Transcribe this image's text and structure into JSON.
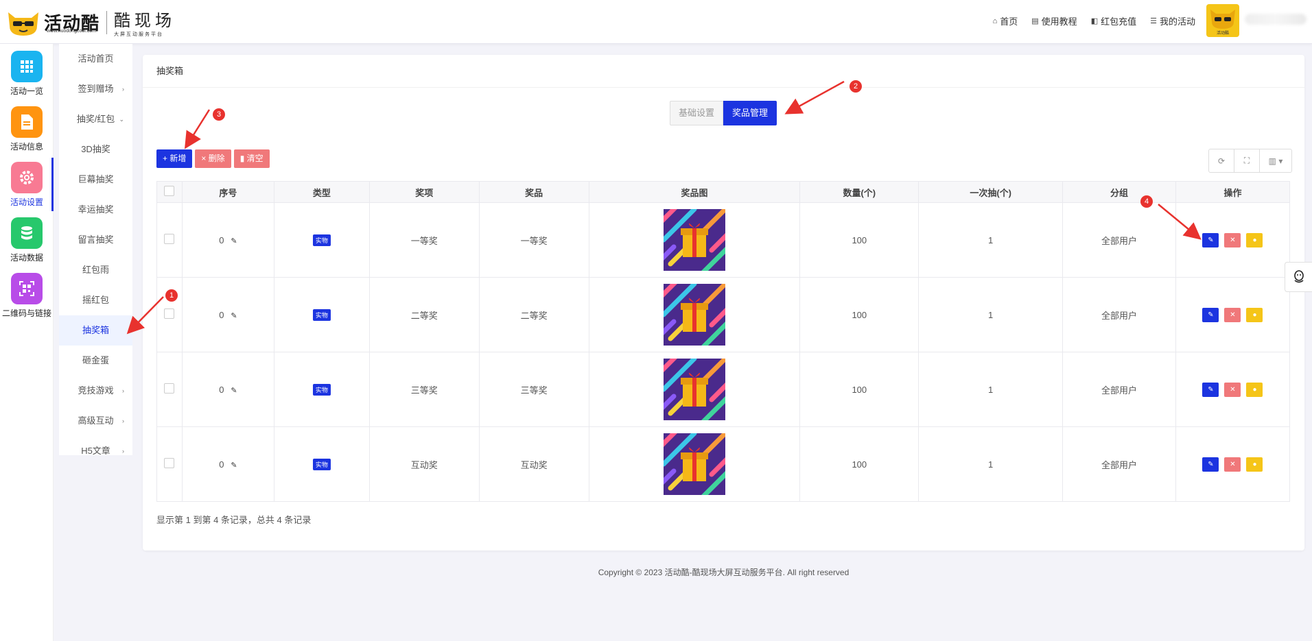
{
  "header": {
    "brand_name": "活动酷",
    "brand_url": "www.huodongcool.com",
    "brand_sub": "酷现场",
    "brand_sub_small": "大屏互动服务平台",
    "nav": [
      {
        "icon": "home-icon",
        "label": "首页"
      },
      {
        "icon": "book-icon",
        "label": "使用教程"
      },
      {
        "icon": "wallet-icon",
        "label": "红包充值"
      },
      {
        "icon": "list-icon",
        "label": "我的活动"
      }
    ],
    "avatar_caption": "活动酷"
  },
  "rail": [
    {
      "label": "活动一览",
      "icon": "grid-icon",
      "color": "#1ab4f0"
    },
    {
      "label": "活动信息",
      "icon": "document-icon",
      "color": "#ff9410"
    },
    {
      "label": "活动设置",
      "icon": "gear-icon",
      "color": "#f87a93",
      "active": true
    },
    {
      "label": "活动数据",
      "icon": "database-icon",
      "color": "#27c86c"
    },
    {
      "label": "二维码与链接",
      "icon": "qrcode-icon",
      "color": "#b84ce8"
    }
  ],
  "submenu": [
    {
      "label": "活动首页",
      "chevron": ""
    },
    {
      "label": "签到赠场",
      "chevron": "›"
    },
    {
      "label": "抽奖/红包",
      "chevron": "⌄"
    },
    {
      "label": "3D抽奖",
      "chevron": ""
    },
    {
      "label": "巨幕抽奖",
      "chevron": ""
    },
    {
      "label": "幸运抽奖",
      "chevron": ""
    },
    {
      "label": "留言抽奖",
      "chevron": ""
    },
    {
      "label": "红包雨",
      "chevron": ""
    },
    {
      "label": "摇红包",
      "chevron": ""
    },
    {
      "label": "抽奖箱",
      "chevron": "",
      "active": true
    },
    {
      "label": "砸金蛋",
      "chevron": ""
    },
    {
      "label": "竞技游戏",
      "chevron": "›"
    },
    {
      "label": "高级互动",
      "chevron": "›"
    },
    {
      "label": "H5文章",
      "chevron": "›"
    }
  ],
  "card": {
    "title": "抽奖箱",
    "tabs": [
      "基础设置",
      "奖品管理"
    ],
    "toolbar": {
      "add": "+ 新增",
      "delete": "× 删除",
      "clear": "清空"
    },
    "columns": [
      "序号",
      "类型",
      "奖项",
      "奖品",
      "奖品图",
      "数量(个)",
      "一次抽(个)",
      "分组",
      "操作"
    ],
    "rows": [
      {
        "index": "0",
        "type": "实物",
        "award": "一等奖",
        "prize": "一等奖",
        "qty": "100",
        "per_draw": "1",
        "group": "全部用户"
      },
      {
        "index": "0",
        "type": "实物",
        "award": "二等奖",
        "prize": "二等奖",
        "qty": "100",
        "per_draw": "1",
        "group": "全部用户"
      },
      {
        "index": "0",
        "type": "实物",
        "award": "三等奖",
        "prize": "三等奖",
        "qty": "100",
        "per_draw": "1",
        "group": "全部用户"
      },
      {
        "index": "0",
        "type": "实物",
        "award": "互动奖",
        "prize": "互动奖",
        "qty": "100",
        "per_draw": "1",
        "group": "全部用户"
      }
    ],
    "pager": "显示第 1 到第 4 条记录，总共 4 条记录"
  },
  "footer": "Copyright © 2023 活动酷-酷现场大屏互动服务平台. All right reserved",
  "annotations": [
    "1",
    "2",
    "3",
    "4"
  ],
  "colors": {
    "primary": "#1c34e0",
    "danger": "#f0787a",
    "warning": "#f5c518",
    "annotation": "#e8322e"
  }
}
